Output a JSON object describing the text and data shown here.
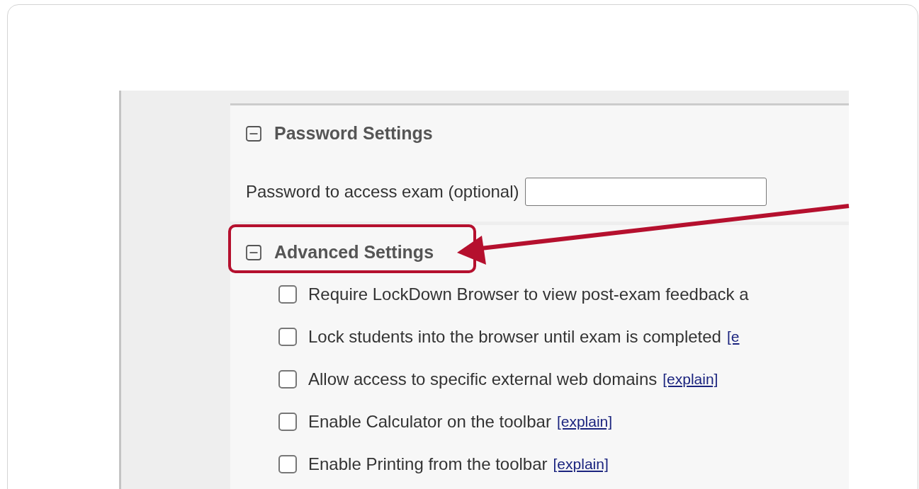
{
  "password_section": {
    "title": "Password Settings",
    "expanded": true,
    "field": {
      "label": "Password to access exam (optional)"
    }
  },
  "advanced_section": {
    "title": "Advanced Settings",
    "expanded": true,
    "highlighted": true,
    "options": [
      {
        "label": "Require LockDown Browser to view post-exam feedback a",
        "checked": false
      },
      {
        "label": "Lock students into the browser until exam is completed",
        "checked": false,
        "link": "[e"
      },
      {
        "label": "Allow access to specific external web domains",
        "checked": false,
        "link": "[explain]"
      },
      {
        "label": "Enable Calculator on the toolbar",
        "checked": false,
        "link": "[explain]"
      },
      {
        "label": "Enable Printing from the toolbar",
        "checked": false,
        "link": "[explain]"
      }
    ]
  }
}
